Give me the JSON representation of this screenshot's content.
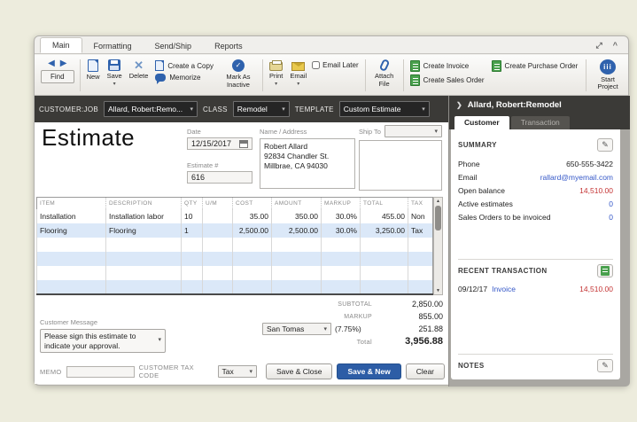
{
  "icons": {
    "back": "◀",
    "forward": "▶",
    "delete": "✕",
    "check": "✓",
    "caret": "▾",
    "pencil": "✎",
    "chevron_up": "^",
    "resize": "⤢",
    "panel_arrow": "❯",
    "scroll_up": "▲",
    "scroll_down": "▼",
    "start_project_glyph": "iii"
  },
  "window": {
    "tabs": {
      "main": "Main",
      "formatting": "Formatting",
      "sendship": "Send/Ship",
      "reports": "Reports"
    }
  },
  "toolbar": {
    "find": "Find",
    "new": "New",
    "save": "Save",
    "delete": "Delete",
    "create_copy": "Create a Copy",
    "memorize": "Memorize",
    "mark_inactive": "Mark As Inactive",
    "print": "Print",
    "email": "Email",
    "email_later": "Email Later",
    "attach": "Attach File",
    "create_invoice": "Create Invoice",
    "create_sales_order": "Create Sales Order",
    "create_po": "Create Purchase Order",
    "start_project": "Start Project"
  },
  "custbar": {
    "customer_job_label": "CUSTOMER:JOB",
    "customer_job": "Allard, Robert:Remo...",
    "class_label": "CLASS",
    "class": "Remodel",
    "template_label": "TEMPLATE",
    "template": "Custom Estimate"
  },
  "estimate": {
    "title": "Estimate",
    "date_label": "Date",
    "date": "12/15/2017",
    "number_label": "Estimate #",
    "number": "616",
    "name_address_label": "Name / Address",
    "address": [
      "Robert Allard",
      "92834 Chandler St.",
      "Millbrae, CA 94030"
    ],
    "ship_to_label": "Ship To",
    "ship_to": ""
  },
  "table": {
    "columns": [
      "ITEM",
      "DESCRIPTION",
      "QTY",
      "U/M",
      "COST",
      "AMOUNT",
      "MARKUP",
      "TOTAL",
      "TAX"
    ],
    "rows": [
      {
        "item": "Installation",
        "description": "Installation labor",
        "qty": "10",
        "um": "",
        "cost": "35.00",
        "amount": "350.00",
        "markup": "30.0%",
        "total": "455.00",
        "tax": "Non"
      },
      {
        "item": "Flooring",
        "description": "Flooring",
        "qty": "1",
        "um": "",
        "cost": "2,500.00",
        "amount": "2,500.00",
        "markup": "30.0%",
        "total": "3,250.00",
        "tax": "Tax"
      }
    ]
  },
  "totals": {
    "subtotal_label": "SUBTOTAL",
    "subtotal": "2,850.00",
    "markup_label": "MARKUP",
    "markup": "855.00",
    "tax_name": "San Tomas",
    "tax_rate": "(7.75%)",
    "tax_amount": "251.88",
    "total_label": "Total",
    "total": "3,956.88"
  },
  "message": {
    "label": "Customer Message",
    "value": "Please sign this estimate to indicate your approval."
  },
  "footer": {
    "memo_label": "MEMO",
    "memo": "",
    "tax_code_label": "CUSTOMER TAX CODE",
    "tax_code": "Tax",
    "save_close": "Save & Close",
    "save_new": "Save & New",
    "clear": "Clear"
  },
  "panel": {
    "header": "Allard, Robert:Remodel",
    "tab_customer": "Customer",
    "tab_transaction": "Transaction",
    "summary": {
      "title": "SUMMARY",
      "rows": [
        {
          "label": "Phone",
          "value": "650-555-3422"
        },
        {
          "label": "Email",
          "value": "rallard@myemail.com"
        },
        {
          "label": "Open balance",
          "value": "14,510.00"
        },
        {
          "label": "Active estimates",
          "value": "0"
        },
        {
          "label": "Sales Orders to be invoiced",
          "value": "0"
        }
      ]
    },
    "recent": {
      "title": "RECENT TRANSACTION",
      "date": "09/12/17",
      "type": "Invoice",
      "amount": "14,510.00"
    },
    "notes_title": "NOTES"
  },
  "colors": {
    "accent_blue": "#2d5da6",
    "link_blue": "#3558c8",
    "alert_red": "#c43434",
    "dark_bar": "#3b3a37",
    "row_alt": "#dbe8f8"
  }
}
